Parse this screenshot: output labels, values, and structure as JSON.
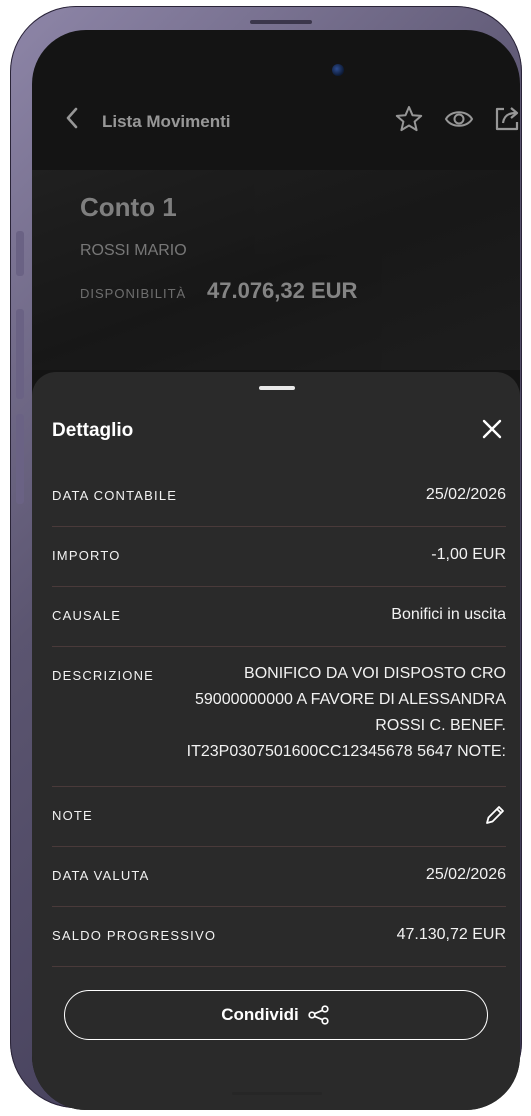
{
  "header": {
    "title": "Lista Movimenti"
  },
  "account": {
    "name": "Conto 1",
    "holder": "ROSSI MARIO",
    "availability_label": "DISPONIBILITÀ",
    "availability_value": "47.076,32 EUR"
  },
  "detail": {
    "title": "Dettaglio",
    "rows": [
      {
        "label": "DATA CONTABILE",
        "value": "25/02/2026"
      },
      {
        "label": "IMPORTO",
        "value": "-1,00 EUR"
      },
      {
        "label": "CAUSALE",
        "value": "Bonifici in uscita"
      },
      {
        "label": "DESCRIZIONE",
        "lines": [
          "BONIFICO DA VOI DISPOSTO CRO",
          "59000000000 A FAVORE DI ALESSANDRA",
          "ROSSI C. BENEF.",
          "IT23P0307501600CC12345678 5647 NOTE:"
        ]
      },
      {
        "label": "NOTE",
        "icon": "pencil-icon"
      },
      {
        "label": "DATA VALUTA",
        "value": "25/02/2026"
      },
      {
        "label": "SALDO PROGRESSIVO",
        "value": "47.130,72 EUR"
      }
    ],
    "share_label": "Condividi"
  },
  "icons": [
    "back-icon",
    "star-icon",
    "eye-icon",
    "share-icon",
    "close-icon",
    "pencil-icon",
    "share-nodes-icon"
  ],
  "colors": {
    "sheet_background": "#2a2a2a",
    "divider": "#4a3a3a",
    "text": "#f2f2f2"
  }
}
